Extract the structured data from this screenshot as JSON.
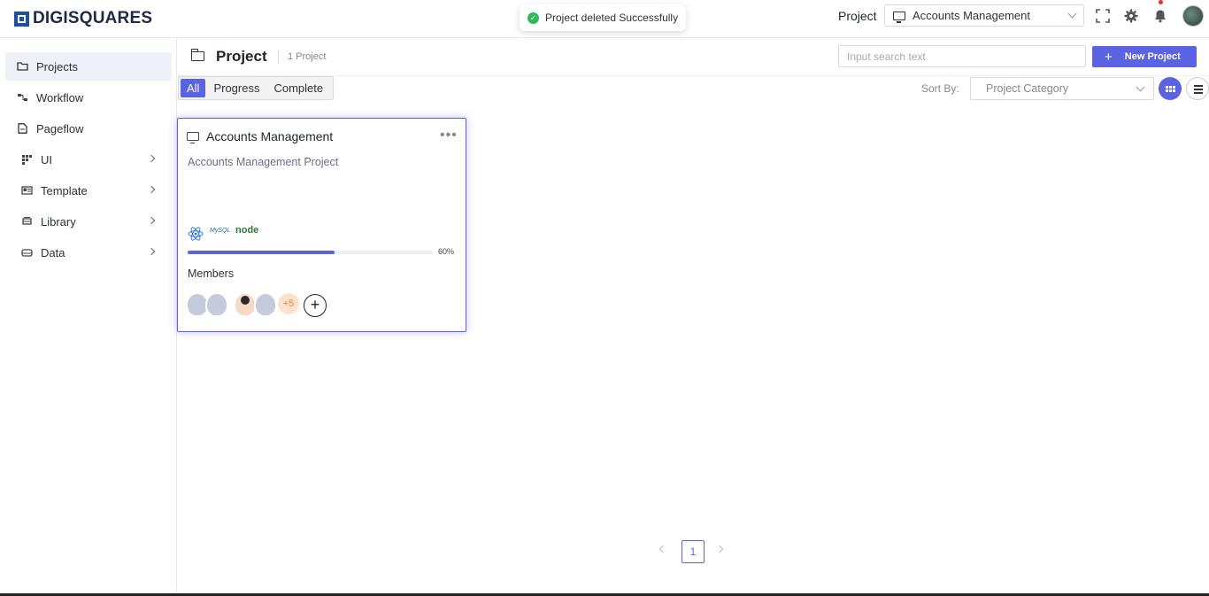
{
  "brand": {
    "name": "DIGISQUARES"
  },
  "toast": {
    "message": "Project deleted Successfully",
    "status_color": "#2dbb55"
  },
  "topbar": {
    "project_label": "Project",
    "project_selected": "Accounts Management"
  },
  "sidebar": {
    "items": [
      {
        "label": "Projects",
        "icon": "folder-icon",
        "active": true
      },
      {
        "label": "Workflow",
        "icon": "workflow-icon"
      },
      {
        "label": "Pageflow",
        "icon": "file-icon"
      },
      {
        "label": "UI",
        "icon": "ui-grid-icon",
        "expandable": true
      },
      {
        "label": "Template",
        "icon": "template-icon",
        "expandable": true
      },
      {
        "label": "Library",
        "icon": "library-icon",
        "expandable": true
      },
      {
        "label": "Data",
        "icon": "database-icon",
        "expandable": true
      }
    ]
  },
  "main": {
    "title": "Project",
    "count": "1 Project",
    "search_placeholder": "Input search text",
    "new_button": "New Project",
    "filters": [
      "All",
      "Progress",
      "Complete"
    ],
    "active_filter": "All",
    "sort_label": "Sort By:",
    "sort_placeholder": "Project Category"
  },
  "card": {
    "title": "Accounts Management",
    "description": "Accounts Management Project",
    "tech": [
      "react",
      "MySQL",
      "node"
    ],
    "progress": 60,
    "progress_text": "60%",
    "members_label": "Members",
    "members_more": "+5",
    "add_symbol": "+"
  },
  "pagination": {
    "current": "1"
  },
  "colors": {
    "accent": "#5b63e3",
    "brand": "#1d4fa3"
  }
}
